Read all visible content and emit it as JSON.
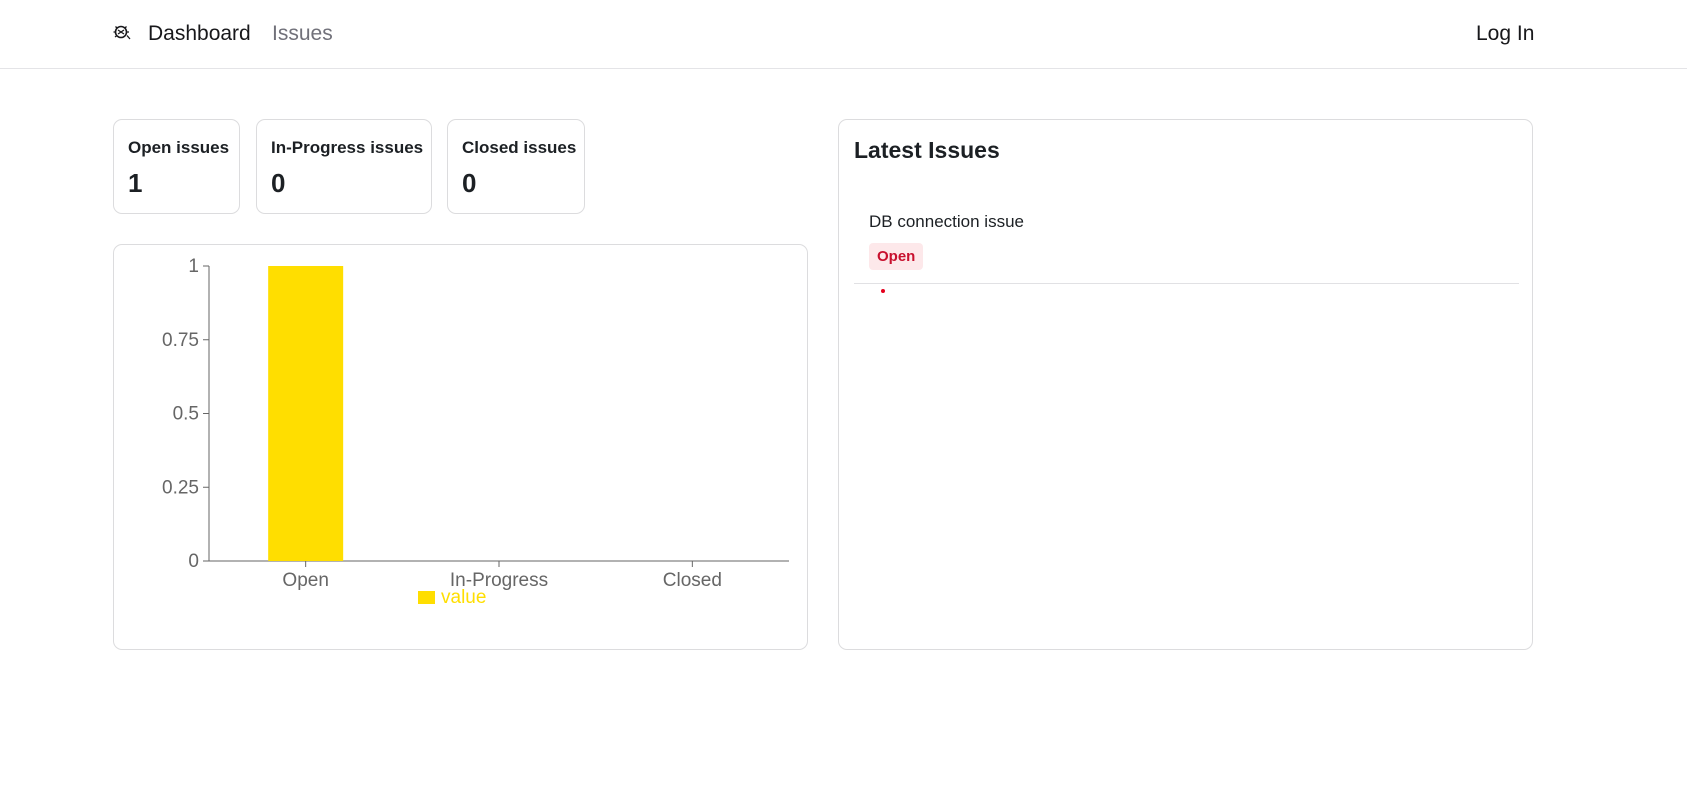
{
  "nav": {
    "logo_icon": "bug-icon",
    "dashboard_label": "Dashboard",
    "issues_label": "Issues",
    "login_label": "Log In"
  },
  "stats": [
    {
      "label": "Open issues",
      "value": "1"
    },
    {
      "label": "In-Progress issues",
      "value": "0"
    },
    {
      "label": "Closed issues",
      "value": "0"
    }
  ],
  "chart_data": {
    "type": "bar",
    "categories": [
      "Open",
      "In-Progress",
      "Closed"
    ],
    "series": [
      {
        "name": "value",
        "values": [
          1,
          0,
          0
        ]
      }
    ],
    "ylim": [
      0,
      1
    ],
    "yticks": [
      "0",
      "0.25",
      "0.5",
      "0.75",
      "1"
    ],
    "legend": "bottom",
    "grid": false,
    "bar_color": "#ffde00"
  },
  "latest": {
    "title": "Latest Issues",
    "issues": [
      {
        "title": "DB connection issue",
        "status": "Open"
      }
    ]
  },
  "colors": {
    "badge_open_text": "#c8102e",
    "dot": "#e5001d"
  }
}
